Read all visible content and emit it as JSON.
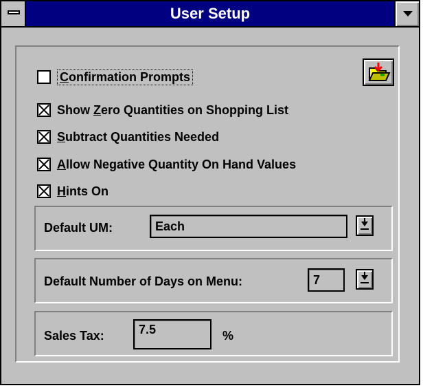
{
  "window": {
    "title": "User Setup",
    "title_bar_color": "#000080",
    "face_color": "#c0c0c0"
  },
  "icons": {
    "system_menu": "system-menu-icon",
    "minimize": "minimize-arrow-icon",
    "folder": "open-folder-icon",
    "dropdown": "dropdown-arrow-icon"
  },
  "checkboxes": [
    {
      "label_pre": "",
      "label_u": "C",
      "label_post": "onfirmation Prompts",
      "checked": false
    },
    {
      "label_pre": "Show ",
      "label_u": "Z",
      "label_post": "ero Quantities on Shopping List",
      "checked": true
    },
    {
      "label_pre": "",
      "label_u": "S",
      "label_post": "ubtract Quantities Needed",
      "checked": true
    },
    {
      "label_pre": "",
      "label_u": "A",
      "label_post": "llow Negative Quantity On Hand Values",
      "checked": true
    },
    {
      "label_pre": "",
      "label_u": "H",
      "label_post": "ints On",
      "checked": true
    }
  ],
  "default_um": {
    "label": "Default UM:",
    "value": "Each"
  },
  "default_days": {
    "label": "Default Number of Days on Menu:",
    "value": "7"
  },
  "sales_tax": {
    "label": "Sales Tax:",
    "value": "7.5",
    "unit": "%"
  }
}
